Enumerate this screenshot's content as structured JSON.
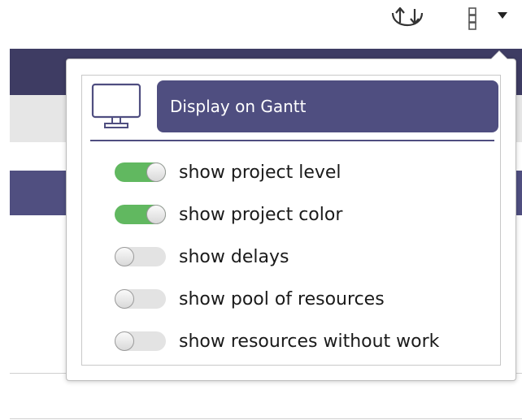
{
  "toolbar": {
    "icons": [
      "sync-icon",
      "columns-icon",
      "dropdown-caret-icon"
    ]
  },
  "display_settings": {
    "icon": "monitor-icon",
    "title": "Display on Gantt",
    "accent_color": "#4f4e80",
    "toggle_on_color": "#61b860",
    "toggle_off_color": "#e3e3e3",
    "options": [
      {
        "label": "show project level",
        "enabled": true
      },
      {
        "label": "show project color",
        "enabled": true
      },
      {
        "label": "show delays",
        "enabled": false
      },
      {
        "label": "show pool of resources",
        "enabled": false
      },
      {
        "label": "show resources without work",
        "enabled": false
      }
    ]
  }
}
